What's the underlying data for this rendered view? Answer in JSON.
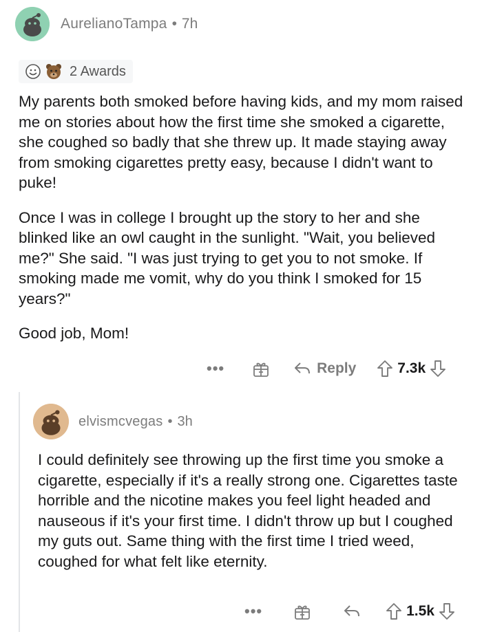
{
  "comment": {
    "username": "AurelianoTampa",
    "separator": "•",
    "age": "7h",
    "awards_label": "2 Awards",
    "paragraphs": [
      "My parents both smoked before having kids, and my mom raised me on stories about how the first time she smoked a cigarette, she coughed so badly that she threw up. It made staying away from smoking cigarettes pretty easy, because I didn't want to puke!",
      "Once I was in college I brought up the story to her and she blinked like an owl caught in the sunlight. \"Wait, you believed me?\" She said. \"I was just trying to get you to not smoke. If smoking made me vomit, why do you think I smoked for 15 years?\"",
      "Good job, Mom!"
    ],
    "more_label": "•••",
    "reply_label": "Reply",
    "votes": "7.3k"
  },
  "reply": {
    "username": "elvismcvegas",
    "separator": "•",
    "age": "3h",
    "paragraphs": [
      "I could definitely see throwing up the first time you smoke a cigarette, especially if it's a really strong one. Cigarettes taste horrible and the nicotine makes you feel light headed and nauseous if it's your first time. I didn't throw up but I coughed my guts out. Same thing with the first time I tried weed, coughed for what felt like eternity."
    ],
    "more_label": "•••",
    "votes": "1.5k"
  },
  "colors": {
    "avatar_top": "#8fd1b2",
    "avatar_reply": "#e0b98f",
    "meta_text": "#7c7c7c",
    "body_text": "#1a1a1b"
  },
  "icons": [
    "snoo-avatar-icon",
    "award-face-icon",
    "award-bear-icon",
    "gift-icon",
    "reply-arrow-icon",
    "upvote-icon",
    "downvote-icon"
  ]
}
